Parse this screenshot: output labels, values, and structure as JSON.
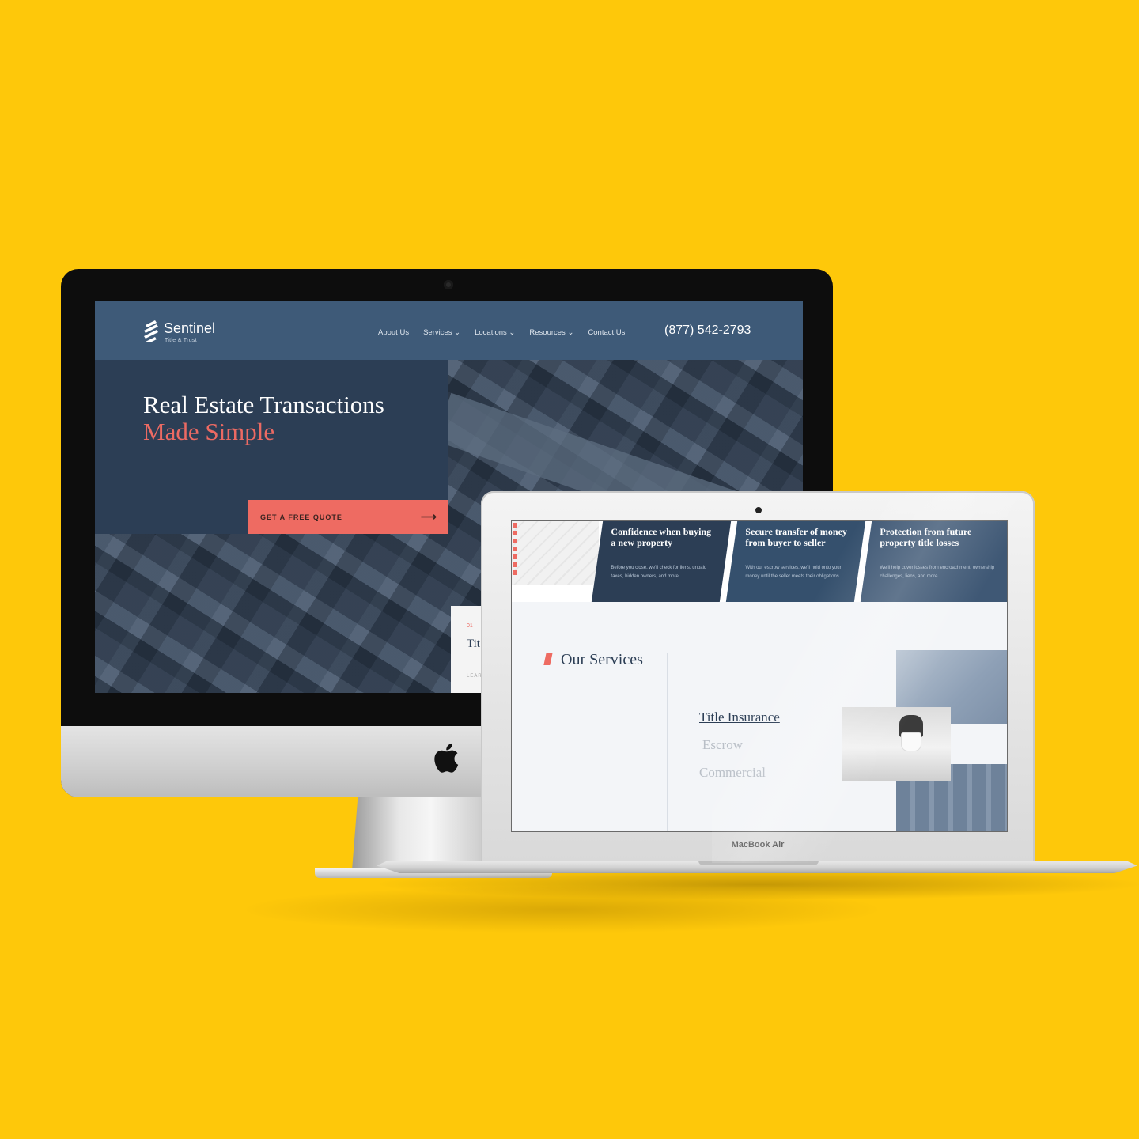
{
  "background": {
    "color": "#FEC80A"
  },
  "desktop_site": {
    "brand": {
      "name": "Sentinel",
      "tagline": "Title & Trust"
    },
    "nav": {
      "items": [
        "About Us",
        "Services ⌄",
        "Locations ⌄",
        "Resources ⌄",
        "Contact Us"
      ],
      "phone": "(877) 542-2793"
    },
    "hero": {
      "title_line1": "Real Estate Transactions",
      "title_line2": "Made Simple",
      "cta_label": "GET A FREE QUOTE",
      "cta_arrow": "⟶"
    },
    "card": {
      "number": "01",
      "title": "Tit",
      "link": "LEAR"
    },
    "colors": {
      "navy": "#2c3e55",
      "nav": "#3e5a78",
      "coral": "#ee6b62"
    }
  },
  "laptop_site": {
    "device_label": "MacBook Air",
    "features": [
      {
        "title": "Confidence when buying a new property",
        "text": "Before you close, we'll check for liens, unpaid taxes, hidden owners, and more."
      },
      {
        "title": "Secure transfer of money from buyer to seller",
        "text": "With our escrow services, we'll hold onto your money until the seller meets their obligations."
      },
      {
        "title": "Protection from future property title losses",
        "text": "We'll help cover losses from encroachment, ownership challenges, liens, and more."
      }
    ],
    "section_title": "Our Services",
    "services": [
      "Title Insurance",
      "Escrow",
      "Commercial"
    ]
  }
}
